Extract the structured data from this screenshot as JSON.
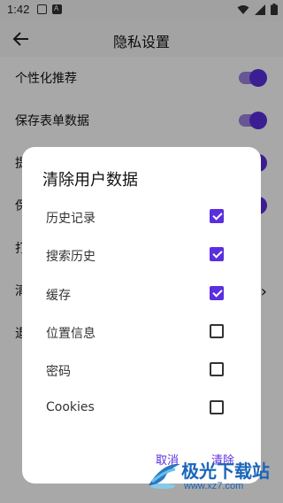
{
  "status_bar": {
    "time": "1:42"
  },
  "app_bar": {
    "title": "隐私设置"
  },
  "settings": {
    "rows": [
      {
        "label": "个性化推荐"
      },
      {
        "label": "保存表单数据"
      },
      {
        "label": "提"
      },
      {
        "label": "保"
      },
      {
        "label": "打"
      },
      {
        "label": "清"
      },
      {
        "label": "退"
      }
    ]
  },
  "dialog": {
    "title": "清除用户数据",
    "items": [
      {
        "label": "历史记录",
        "checked": true
      },
      {
        "label": "搜索历史",
        "checked": true
      },
      {
        "label": "缓存",
        "checked": true
      },
      {
        "label": "位置信息",
        "checked": false
      },
      {
        "label": "密码",
        "checked": false
      },
      {
        "label": "Cookies",
        "checked": false
      }
    ],
    "cancel_label": "取消",
    "clear_label": "清除"
  },
  "watermark": {
    "text": "极光下载站",
    "url": "www.xz7.com"
  },
  "colors": {
    "accent": "#5b2ee0",
    "toggle_track": "#9b83df"
  }
}
